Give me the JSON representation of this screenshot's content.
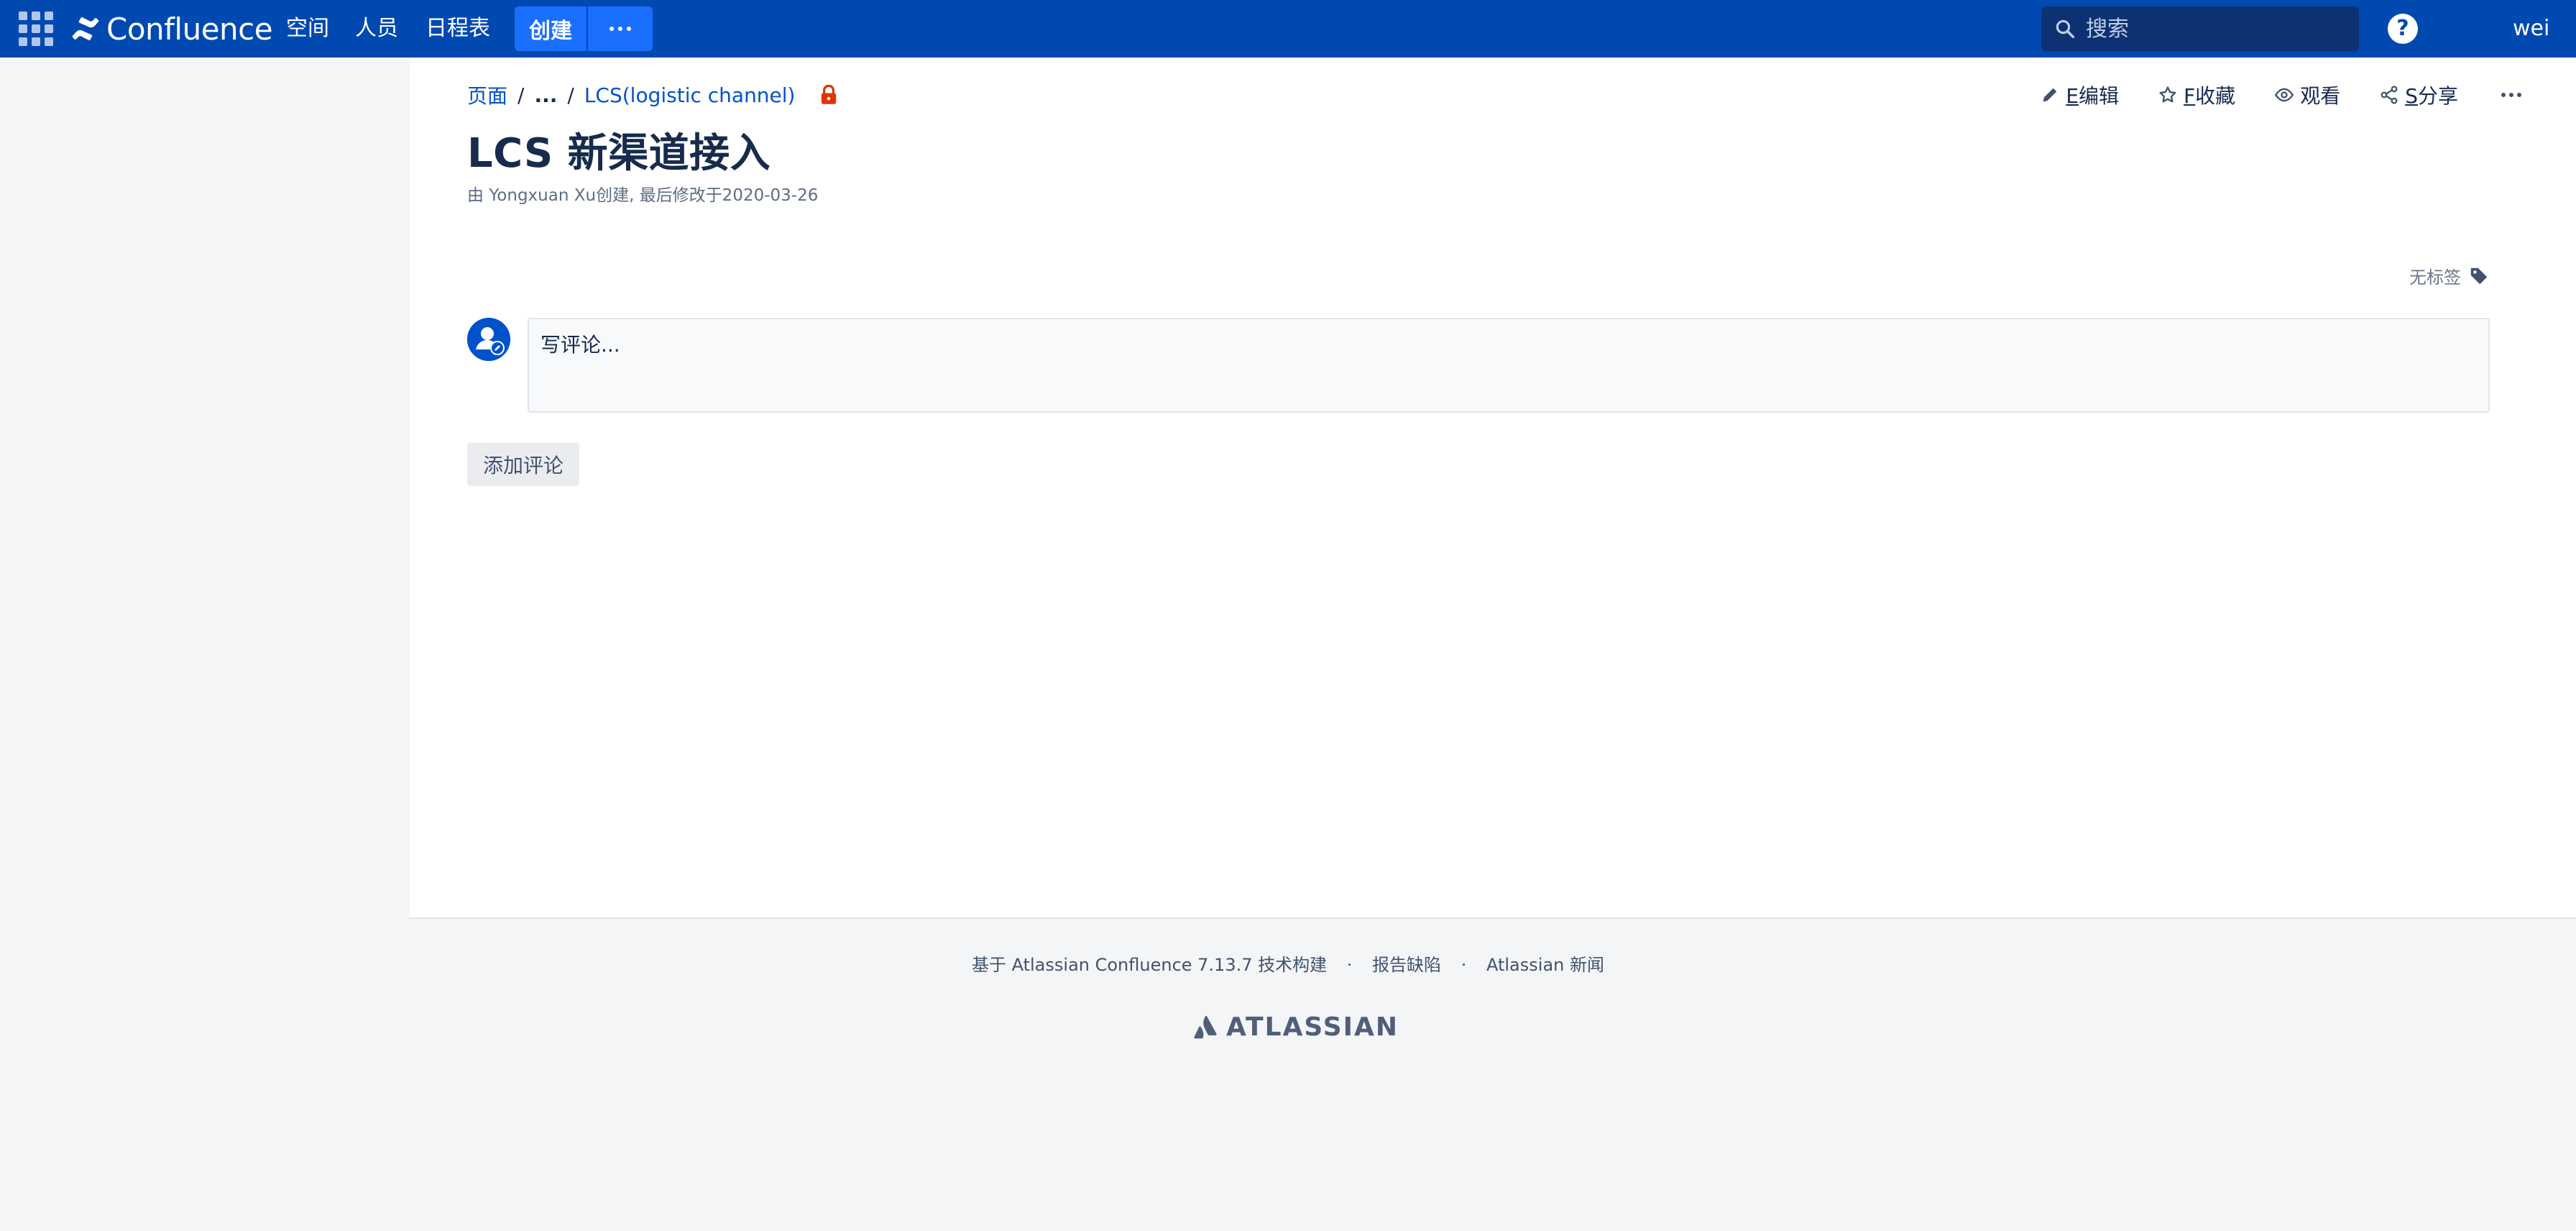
{
  "nav": {
    "logo_text": "Confluence",
    "links": [
      "空间",
      "人员",
      "日程表"
    ],
    "create_label": "创建",
    "search_placeholder": "搜索",
    "help_label": "?",
    "user_name": "wei"
  },
  "breadcrumb": {
    "root": "页面",
    "ellipsis": "...",
    "parent": "LCS(logistic channel)"
  },
  "actions": {
    "edit": "编辑",
    "edit_key": "E",
    "favorite": "收藏",
    "favorite_key": "F",
    "watch": "观看",
    "share": "分享",
    "share_key": "S"
  },
  "page": {
    "title": "LCS 新渠道接入",
    "meta_prefix": "由 ",
    "author": "Yongxuan Xu",
    "meta_suffix": "创建, 最后修改于2020-03-26",
    "labels_text": "无标签"
  },
  "comment": {
    "placeholder": "写评论...",
    "add_button": "添加评论"
  },
  "footer": {
    "powered_by": "基于 Atlassian Confluence 7.13.7 技术构建",
    "report_bug": "报告缺陷",
    "news": "Atlassian 新闻",
    "brand": "ATLASSIAN"
  },
  "colors": {
    "nav_bg": "#0049b0",
    "create_bg": "#1a6fff",
    "link": "#0052cc",
    "lock": "#de350b"
  }
}
